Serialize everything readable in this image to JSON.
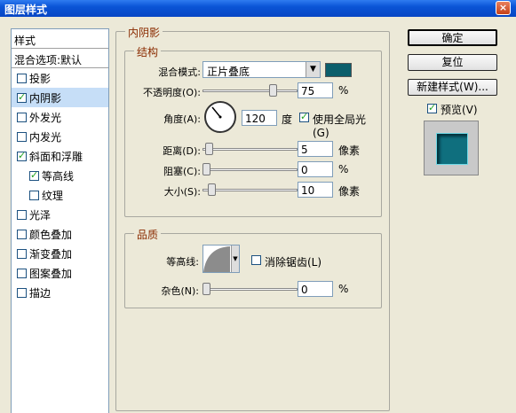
{
  "window": {
    "title": "图层样式",
    "close_label": "×"
  },
  "style_list": {
    "header": "样式",
    "blend_options": "混合选项:默认",
    "items": [
      {
        "label": "投影",
        "checked": false,
        "selected": false,
        "sub": false
      },
      {
        "label": "内阴影",
        "checked": true,
        "selected": true,
        "sub": false
      },
      {
        "label": "外发光",
        "checked": false,
        "selected": false,
        "sub": false
      },
      {
        "label": "内发光",
        "checked": false,
        "selected": false,
        "sub": false
      },
      {
        "label": "斜面和浮雕",
        "checked": true,
        "selected": false,
        "sub": false
      },
      {
        "label": "等高线",
        "checked": true,
        "selected": false,
        "sub": true
      },
      {
        "label": "纹理",
        "checked": false,
        "selected": false,
        "sub": true
      },
      {
        "label": "光泽",
        "checked": false,
        "selected": false,
        "sub": false
      },
      {
        "label": "颜色叠加",
        "checked": false,
        "selected": false,
        "sub": false
      },
      {
        "label": "渐变叠加",
        "checked": false,
        "selected": false,
        "sub": false
      },
      {
        "label": "图案叠加",
        "checked": false,
        "selected": false,
        "sub": false
      },
      {
        "label": "描边",
        "checked": false,
        "selected": false,
        "sub": false
      }
    ]
  },
  "panel": {
    "title": "内阴影",
    "structure": {
      "legend": "结构",
      "blend_mode_label": "混合模式:",
      "blend_mode_value": "正片叠底",
      "shadow_color": "#0b5e6b",
      "opacity_label": "不透明度(O):",
      "opacity_value": "75",
      "opacity_unit": "%",
      "angle_label": "角度(A):",
      "angle_value": "120",
      "angle_unit": "度",
      "global_light_label": "使用全局光(G)",
      "global_light_checked": true,
      "distance_label": "距离(D):",
      "distance_value": "5",
      "distance_unit": "像素",
      "choke_label": "阻塞(C):",
      "choke_value": "0",
      "choke_unit": "%",
      "size_label": "大小(S):",
      "size_value": "10",
      "size_unit": "像素"
    },
    "quality": {
      "legend": "品质",
      "contour_label": "等高线:",
      "anti_alias_label": "消除锯齿(L)",
      "anti_alias_checked": false,
      "noise_label": "杂色(N):",
      "noise_value": "0",
      "noise_unit": "%"
    }
  },
  "buttons": {
    "ok": "确定",
    "reset": "复位",
    "new_style": "新建样式(W)...",
    "preview_label": "预览(V)",
    "preview_checked": true
  }
}
